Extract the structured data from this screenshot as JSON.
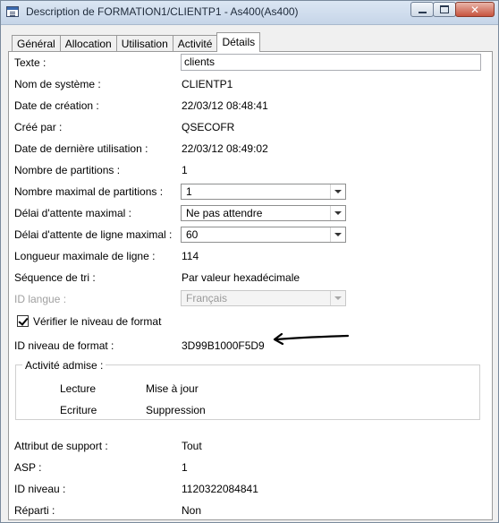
{
  "window": {
    "title": "Description de FORMATION1/CLIENTP1 - As400(As400)",
    "close_glyph": "✕"
  },
  "tabs": [
    {
      "label": "Général"
    },
    {
      "label": "Allocation"
    },
    {
      "label": "Utilisation"
    },
    {
      "label": "Activité"
    },
    {
      "label": "Détails",
      "active": true
    }
  ],
  "details": {
    "texte": {
      "label": "Texte :",
      "value": "clients"
    },
    "nom_systeme": {
      "label": "Nom de système :",
      "value": "CLIENTP1"
    },
    "date_creation": {
      "label": "Date de création :",
      "value": "22/03/12 08:48:41"
    },
    "cree_par": {
      "label": "Créé par :",
      "value": "QSECOFR"
    },
    "date_derniere_utilisation": {
      "label": "Date de dernière utilisation :",
      "value": "22/03/12 08:49:02"
    },
    "nombre_partitions": {
      "label": "Nombre de partitions :",
      "value": "1"
    },
    "nombre_max_partitions": {
      "label": "Nombre maximal de partitions :",
      "value": "1"
    },
    "delai_attente_max": {
      "label": "Délai d'attente maximal :",
      "value": "Ne pas attendre"
    },
    "delai_attente_ligne_max": {
      "label": "Délai d'attente de ligne maximal :",
      "value": "60"
    },
    "longueur_max_ligne": {
      "label": "Longueur maximale de ligne :",
      "value": "114"
    },
    "sequence_tri": {
      "label": "Séquence de tri :",
      "value": "Par valeur hexadécimale"
    },
    "id_langue": {
      "label": "ID langue :",
      "value": "Français"
    },
    "verifier_niveau_format": {
      "label": "Vérifier le niveau de format",
      "checked": true
    },
    "id_niveau_format": {
      "label": "ID niveau de format :",
      "value": "3D99B1000F5D9"
    },
    "activite_admise": {
      "title": "Activité admise :",
      "items": [
        "Lecture",
        "Mise à jour",
        "Ecriture",
        "Suppression"
      ]
    },
    "attribut_support": {
      "label": "Attribut de support :",
      "value": "Tout"
    },
    "asp": {
      "label": "ASP :",
      "value": "1"
    },
    "id_niveau": {
      "label": "ID niveau :",
      "value": "1120322084841"
    },
    "reparti": {
      "label": "Réparti :",
      "value": "Non"
    }
  }
}
